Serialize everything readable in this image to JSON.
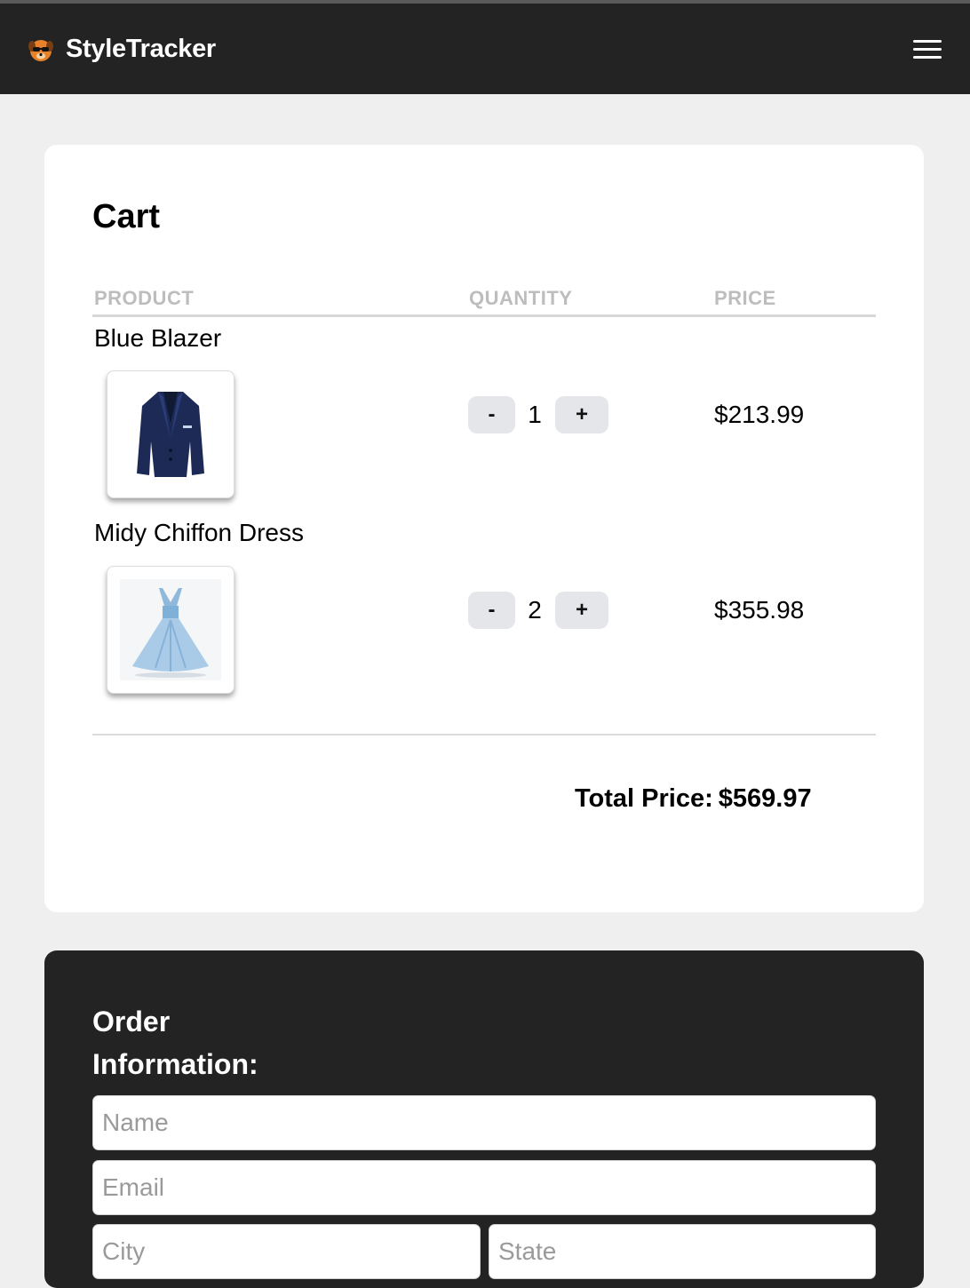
{
  "app": {
    "brand_name": "StyleTracker",
    "logo_icon": "sunglasses-dog-logo",
    "menu_icon": "hamburger-menu-icon"
  },
  "cart": {
    "title": "Cart",
    "columns": {
      "product": "PRODUCT",
      "quantity": "QUANTITY",
      "price": "PRICE"
    },
    "items": [
      {
        "name": "Blue Blazer",
        "image": "blue-blazer-image",
        "quantity": "1",
        "price": "$213.99",
        "minus": "-",
        "plus": "+"
      },
      {
        "name": "Midy Chiffon Dress",
        "image": "chiffon-dress-image",
        "quantity": "2",
        "price": "$355.98",
        "minus": "-",
        "plus": "+"
      }
    ],
    "total_label": "Total Price:",
    "total_value": "$569.97"
  },
  "order": {
    "title": "Order Information:",
    "fields": {
      "name_placeholder": "Name",
      "email_placeholder": "Email",
      "city_placeholder": "City",
      "state_placeholder": "State"
    }
  },
  "colors": {
    "navbar_bg": "#232323",
    "page_bg": "#efefef",
    "order_bg": "#232323",
    "qty_button_bg": "#e4e6ea",
    "header_text": "#bdbdbd"
  }
}
